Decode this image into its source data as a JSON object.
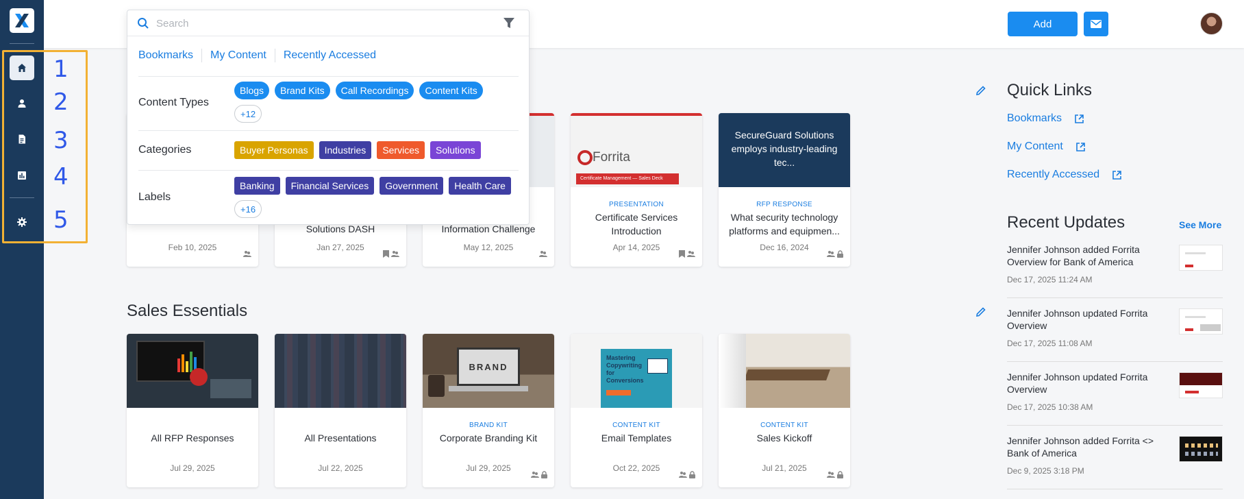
{
  "sidebar": {
    "logo_icon": "x-logo-icon",
    "items": [
      {
        "icon": "home-icon",
        "active": true
      },
      {
        "icon": "user-icon",
        "active": false
      },
      {
        "icon": "document-icon",
        "active": false
      },
      {
        "icon": "bar-chart-icon",
        "active": false
      },
      {
        "icon": "gear-icon",
        "active": false
      }
    ],
    "annotation_numbers": [
      "1",
      "2",
      "3",
      "4",
      "5"
    ]
  },
  "header": {
    "add_label": "Add",
    "mail_icon": "mail-icon"
  },
  "search": {
    "placeholder": "Search",
    "value": "",
    "links": [
      "Bookmarks",
      "My Content",
      "Recently Accessed"
    ],
    "content_types_label": "Content Types",
    "content_types": [
      "Blogs",
      "Brand Kits",
      "Call Recordings",
      "Content Kits"
    ],
    "content_types_more": "+12",
    "categories_label": "Categories",
    "categories": [
      {
        "name": "Buyer Personas",
        "color": "#d9a400"
      },
      {
        "name": "Industries",
        "color": "#3f3fa3"
      },
      {
        "name": "Services",
        "color": "#ef5a2c"
      },
      {
        "name": "Solutions",
        "color": "#7a45d6"
      }
    ],
    "labels_label": "Labels",
    "labels": [
      "Banking",
      "Financial Services",
      "Government",
      "Health Care"
    ],
    "labels_more": "+16"
  },
  "row1": {
    "cards": [
      {
        "type": "",
        "title": "",
        "date": "Feb 10, 2025"
      },
      {
        "type": "",
        "title": "Solutions DASH",
        "date": "Jan 27, 2025"
      },
      {
        "type": "",
        "title": "Information Challenge",
        "date": "May 12, 2025"
      },
      {
        "type": "PRESENTATION",
        "title": "Certificate Services Introduction",
        "date": "Apr 14, 2025",
        "thumb_brand": "Forrita",
        "thumb_banner": "Certificate Management — Sales Deck"
      },
      {
        "type": "RFP RESPONSE",
        "title": "What security technology platforms and equipmen...",
        "date": "Dec 16, 2024",
        "thumb_text": "SecureGuard Solutions employs industry-leading tec..."
      }
    ]
  },
  "sales_essentials": {
    "title": "Sales Essentials",
    "cards": [
      {
        "type": "",
        "title": "All RFP Responses",
        "date": "Jul 29, 2025"
      },
      {
        "type": "",
        "title": "All Presentations",
        "date": "Jul 22, 2025"
      },
      {
        "type": "BRAND KIT",
        "title": "Corporate Branding Kit",
        "date": "Jul 29, 2025",
        "thumb_text": "BRAND"
      },
      {
        "type": "CONTENT KIT",
        "title": "Email Templates",
        "date": "Oct 22, 2025",
        "thumb_text": "Mastering Copywriting for Conversions"
      },
      {
        "type": "CONTENT KIT",
        "title": "Sales Kickoff",
        "date": "Jul 21, 2025"
      }
    ]
  },
  "quick_links": {
    "title": "Quick Links",
    "items": [
      "Bookmarks",
      "My Content",
      "Recently Accessed"
    ]
  },
  "recent_updates": {
    "title": "Recent Updates",
    "see_more": "See More",
    "items": [
      {
        "text": "Jennifer Johnson added Forrita Overview for Bank of America",
        "date": "Dec 17, 2025 11:24 AM"
      },
      {
        "text": "Jennifer Johnson updated Forrita Overview",
        "date": "Dec 17, 2025 11:08 AM"
      },
      {
        "text": "Jennifer Johnson updated Forrita Overview",
        "date": "Dec 17, 2025 10:38 AM"
      },
      {
        "text": "Jennifer Johnson added Forrita <> Bank of America",
        "date": "Dec 9, 2025 3:18 PM"
      }
    ]
  },
  "colors": {
    "sidebar": "#1b3a5c",
    "accent": "#1a8cf0",
    "annotation_box": "#f2b134",
    "annotation_numbers": "#2f58e8"
  }
}
